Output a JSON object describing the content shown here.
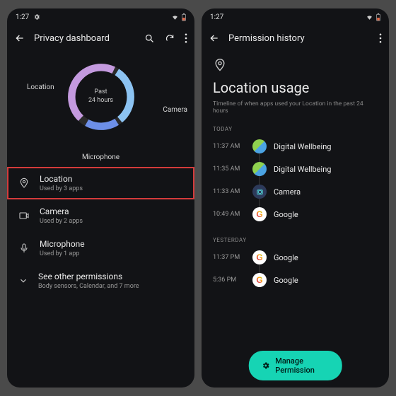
{
  "status": {
    "time": "1:27"
  },
  "left": {
    "title": "Privacy dashboard",
    "chart": {
      "center1": "Past",
      "center2": "24 hours",
      "labels": {
        "location": "Location",
        "camera": "Camera",
        "microphone": "Microphone"
      }
    },
    "rows": {
      "location": {
        "title": "Location",
        "sub": "Used by 3 apps"
      },
      "camera": {
        "title": "Camera",
        "sub": "Used by 2 apps"
      },
      "microphone": {
        "title": "Microphone",
        "sub": "Used by 1 app"
      },
      "other": {
        "title": "See other permissions",
        "sub": "Body sensors, Calendar, and 7 more"
      }
    }
  },
  "right": {
    "title": "Permission history",
    "heading": "Location usage",
    "subtitle": "Timeline of when apps used your Location in the past 24 hours",
    "today_label": "TODAY",
    "yesterday_label": "YESTERDAY",
    "today": [
      {
        "time": "11:37 AM",
        "app": "Digital Wellbeing"
      },
      {
        "time": "11:35 AM",
        "app": "Digital Wellbeing"
      },
      {
        "time": "11:33 AM",
        "app": "Camera"
      },
      {
        "time": "10:49 AM",
        "app": "Google"
      }
    ],
    "yesterday": [
      {
        "time": "11:37 PM",
        "app": "Google"
      },
      {
        "time": "5:36 PM",
        "app": "Google"
      }
    ],
    "manage": "Manage Permission"
  },
  "chart_data": {
    "type": "pie",
    "title": "Past 24 hours",
    "categories": [
      "Location",
      "Camera",
      "Microphone"
    ],
    "values": [
      3,
      2,
      1
    ],
    "colors": [
      "#c49adf",
      "#8cc3f2",
      "#6d8fe8"
    ]
  }
}
